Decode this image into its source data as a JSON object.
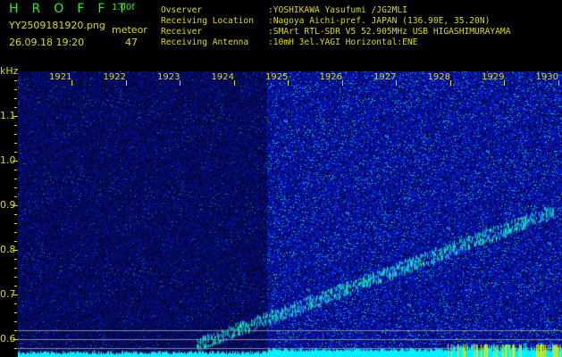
{
  "header": {
    "title": "HROFFT",
    "version": "1.00f",
    "filename": "YY2509181920.png",
    "datetime": "26.09.18 19:20",
    "meteor_label": "meteor",
    "meteor_count": "47"
  },
  "info": [
    {
      "key": "Ovserver",
      "value": ":YOSHIKAWA Yasufumi /JG2MLI"
    },
    {
      "key": "Receiving Location",
      "value": ":Nagoya Aichi-pref. JAPAN (136.90E, 35.20N)"
    },
    {
      "key": "Receiver",
      "value": ":SMArt RTL-SDR V5 52.905MHz USB HIGASHIMURAYAMA"
    },
    {
      "key": "Receiving Antenna",
      "value": ":10mH 3el.YAGI Horizontal:ENE"
    }
  ],
  "spectrogram": {
    "y_unit": "kHz",
    "y_ticks": [
      "1.1",
      "1.0",
      "0.9",
      "0.8",
      "0.7",
      "0.6"
    ],
    "x_ticks": [
      "1921",
      "1922",
      "1923",
      "1924",
      "1925",
      "1926",
      "1927",
      "1928",
      "1929",
      "1930"
    ],
    "colors": {
      "background": "#000000",
      "noise": "#1a1aa0",
      "signal": "#00ffff",
      "label": "#dddd00"
    }
  }
}
